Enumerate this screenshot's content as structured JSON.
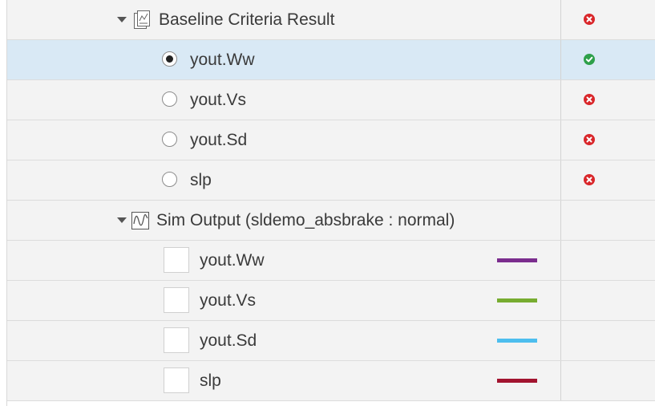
{
  "baseline_group": {
    "label": "Baseline Criteria Result",
    "icon": "baseline-criteria-icon",
    "status": "fail"
  },
  "baseline_items": [
    {
      "label": "yout.Ww",
      "selected": true,
      "status": "pass"
    },
    {
      "label": "yout.Vs",
      "selected": false,
      "status": "fail"
    },
    {
      "label": "yout.Sd",
      "selected": false,
      "status": "fail"
    },
    {
      "label": "slp",
      "selected": false,
      "status": "fail"
    }
  ],
  "sim_group": {
    "label": "Sim Output (sldemo_absbrake : normal)",
    "icon": "signal-waveform-icon"
  },
  "sim_items": [
    {
      "label": "yout.Ww",
      "checked": false,
      "line_color": "#7b2d8e"
    },
    {
      "label": "yout.Vs",
      "checked": false,
      "line_color": "#77ac30"
    },
    {
      "label": "yout.Sd",
      "checked": false,
      "line_color": "#4dbeee"
    },
    {
      "label": "slp",
      "checked": false,
      "line_color": "#a2142f"
    }
  ],
  "colors": {
    "pass": "#2ea04a",
    "fail": "#d9262a",
    "selected_row": "#d9e9f5"
  }
}
